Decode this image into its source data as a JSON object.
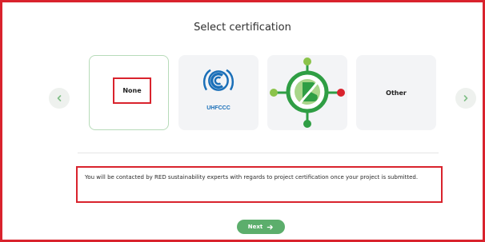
{
  "title": "Select certification",
  "cards": [
    {
      "label": "None",
      "selected": true
    },
    {
      "label": "UHFCCC",
      "icon": "unfccc-logo-icon"
    },
    {
      "label": "",
      "icon": "green-certification-logo-icon"
    },
    {
      "label": "Other"
    }
  ],
  "notice": "You will be contacted by RED sustainability experts with regards to project certification once your project is submitted.",
  "next_label": "Next",
  "icons": {
    "prev": "chevron-left-icon",
    "next": "chevron-right-icon",
    "next_arrow": "arrow-right-icon"
  },
  "colors": {
    "accent_green": "#5cae6c",
    "highlight_red": "#d9232d",
    "unfccc_blue": "#1a6fb8"
  }
}
